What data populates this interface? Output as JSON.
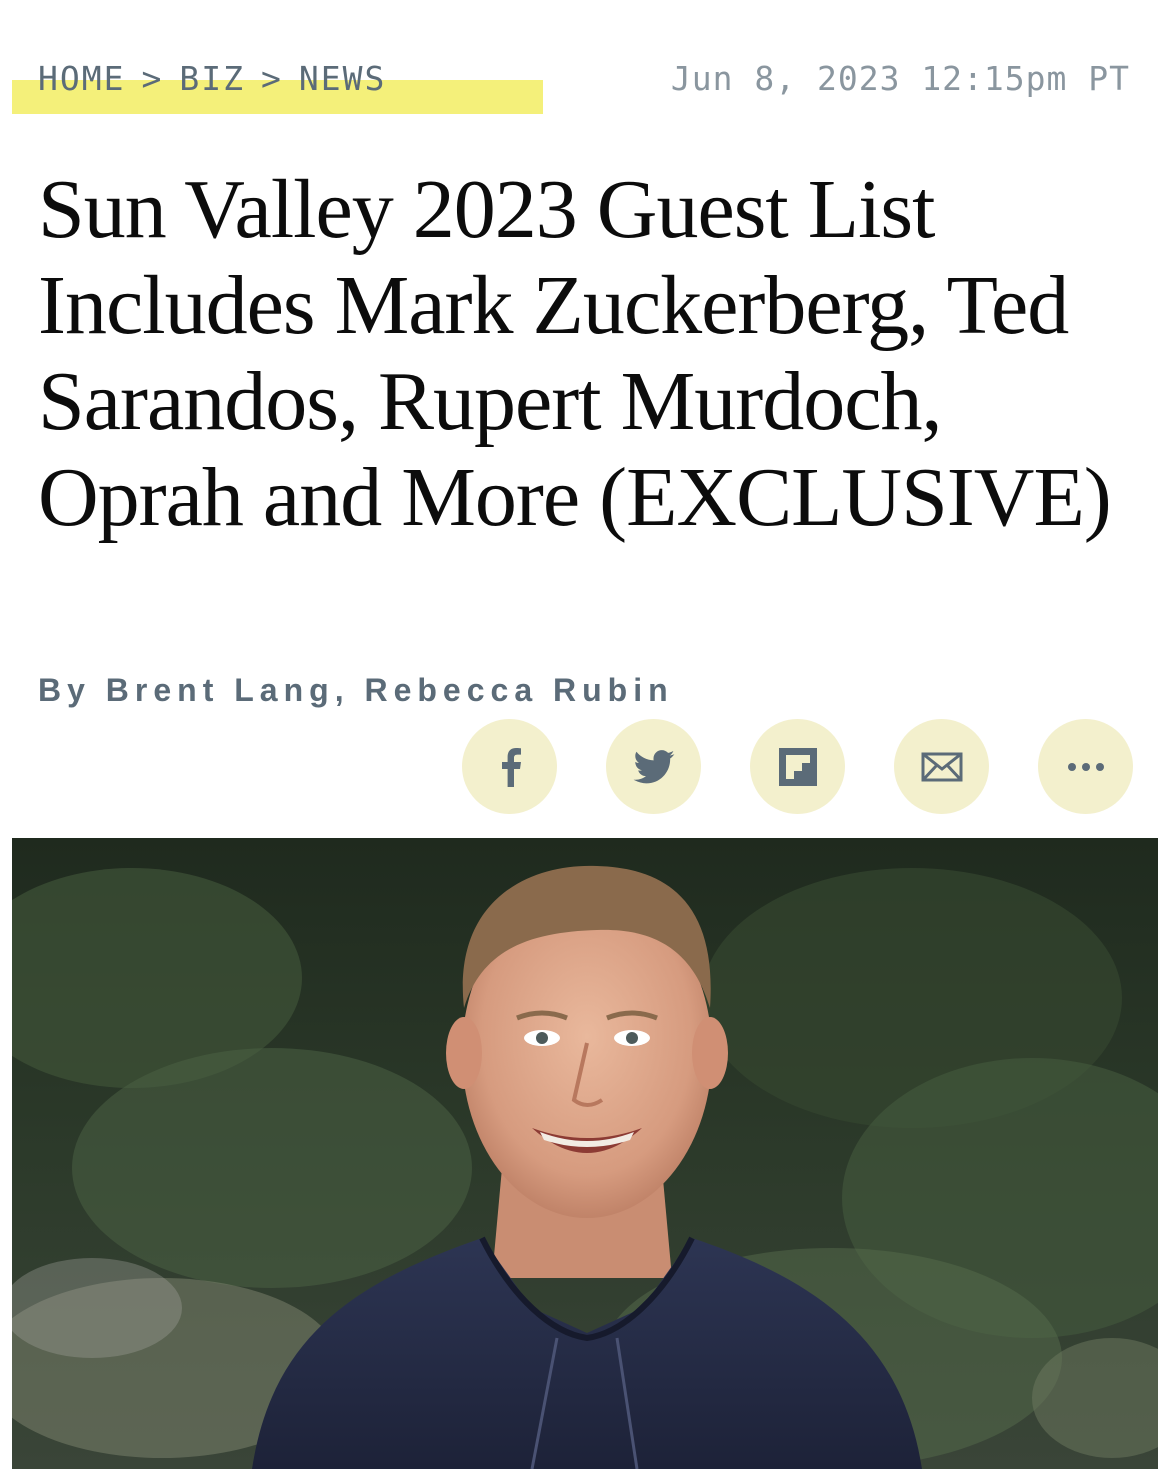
{
  "breadcrumb": {
    "items": [
      "HOME",
      "BIZ",
      "NEWS"
    ],
    "separator": ">"
  },
  "timestamp": "Jun 8, 2023 12:15pm PT",
  "headline": "Sun Valley 2023 Guest List Includes Mark Zuckerberg, Ted Sarandos, Rupert Murdoch, Oprah and More (EXCLUSIVE)",
  "byline": "By Brent Lang, Rebecca Rubin",
  "share_buttons": [
    "facebook-icon",
    "twitter-icon",
    "flipboard-icon",
    "email-icon",
    "more-icon"
  ],
  "colors": {
    "highlight": "#f4f07a",
    "share_bg": "#f3f0cd",
    "meta_text": "#5b6b78",
    "icon": "#5b6b78"
  }
}
